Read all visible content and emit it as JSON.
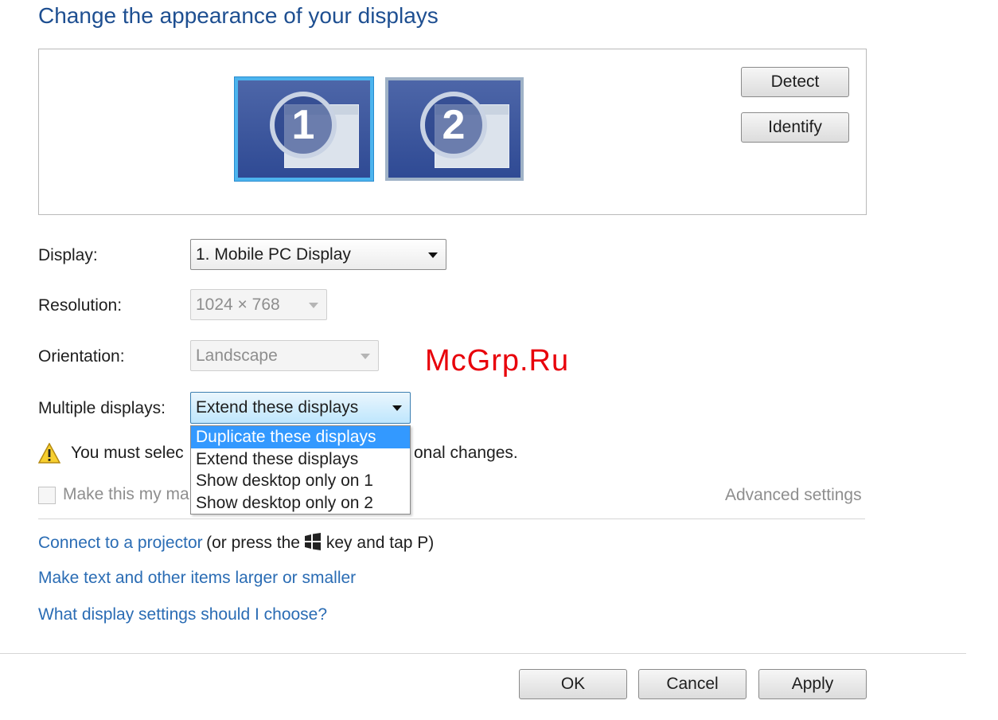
{
  "title": "Change the appearance of your displays",
  "preview": {
    "monitors": [
      {
        "number": "1",
        "selected": true
      },
      {
        "number": "2",
        "selected": false
      }
    ],
    "detect_label": "Detect",
    "identify_label": "Identify"
  },
  "display": {
    "label": "Display:",
    "value": "1. Mobile PC Display"
  },
  "resolution": {
    "label": "Resolution:",
    "value": "1024 × 768"
  },
  "orientation": {
    "label": "Orientation:",
    "value": "Landscape"
  },
  "multiple_displays": {
    "label": "Multiple displays:",
    "value": "Extend these displays",
    "options": [
      "Duplicate these displays",
      "Extend these displays",
      "Show desktop only on 1",
      "Show desktop only on 2"
    ],
    "highlighted_option": "Duplicate these displays"
  },
  "warning": {
    "text_start": "You must selec",
    "text_end": "onal changes."
  },
  "main_display_checkbox": {
    "label": "Make this my ma",
    "checked": false
  },
  "advanced_link": "Advanced settings",
  "links": {
    "projector": "Connect to a projector",
    "projector_hint_before": "(or press the",
    "projector_hint_after": "key and tap P)",
    "text_size": "Make text and other items larger or smaller",
    "help": "What display settings should I choose?"
  },
  "footer": {
    "ok": "OK",
    "cancel": "Cancel",
    "apply": "Apply"
  },
  "watermark": "McGrp.Ru",
  "colors": {
    "title": "#1e4f91",
    "link": "#2a6cb4",
    "highlight": "#3399ff",
    "watermark": "#e8000a"
  }
}
